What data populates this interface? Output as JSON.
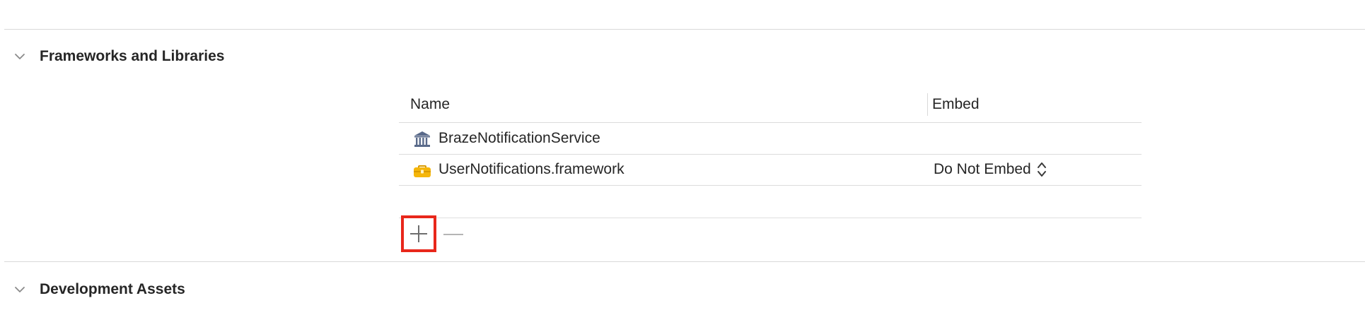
{
  "sections": {
    "frameworks": {
      "title": "Frameworks and Libraries",
      "expanded": true
    },
    "dev_assets": {
      "title": "Development Assets",
      "expanded": true
    }
  },
  "table": {
    "columns": {
      "name": "Name",
      "embed": "Embed"
    },
    "rows": [
      {
        "icon": "library-icon",
        "name": "BrazeNotificationService",
        "embed": ""
      },
      {
        "icon": "framework-toolbox-icon",
        "name": "UserNotifications.framework",
        "embed": "Do Not Embed"
      }
    ]
  },
  "toolbar": {
    "add": "add-icon",
    "remove": "remove-icon",
    "highlight_color": "#e8271b"
  },
  "colors": {
    "framework_icon": "#f5b60a",
    "library_icon": "#5a6a8a"
  }
}
